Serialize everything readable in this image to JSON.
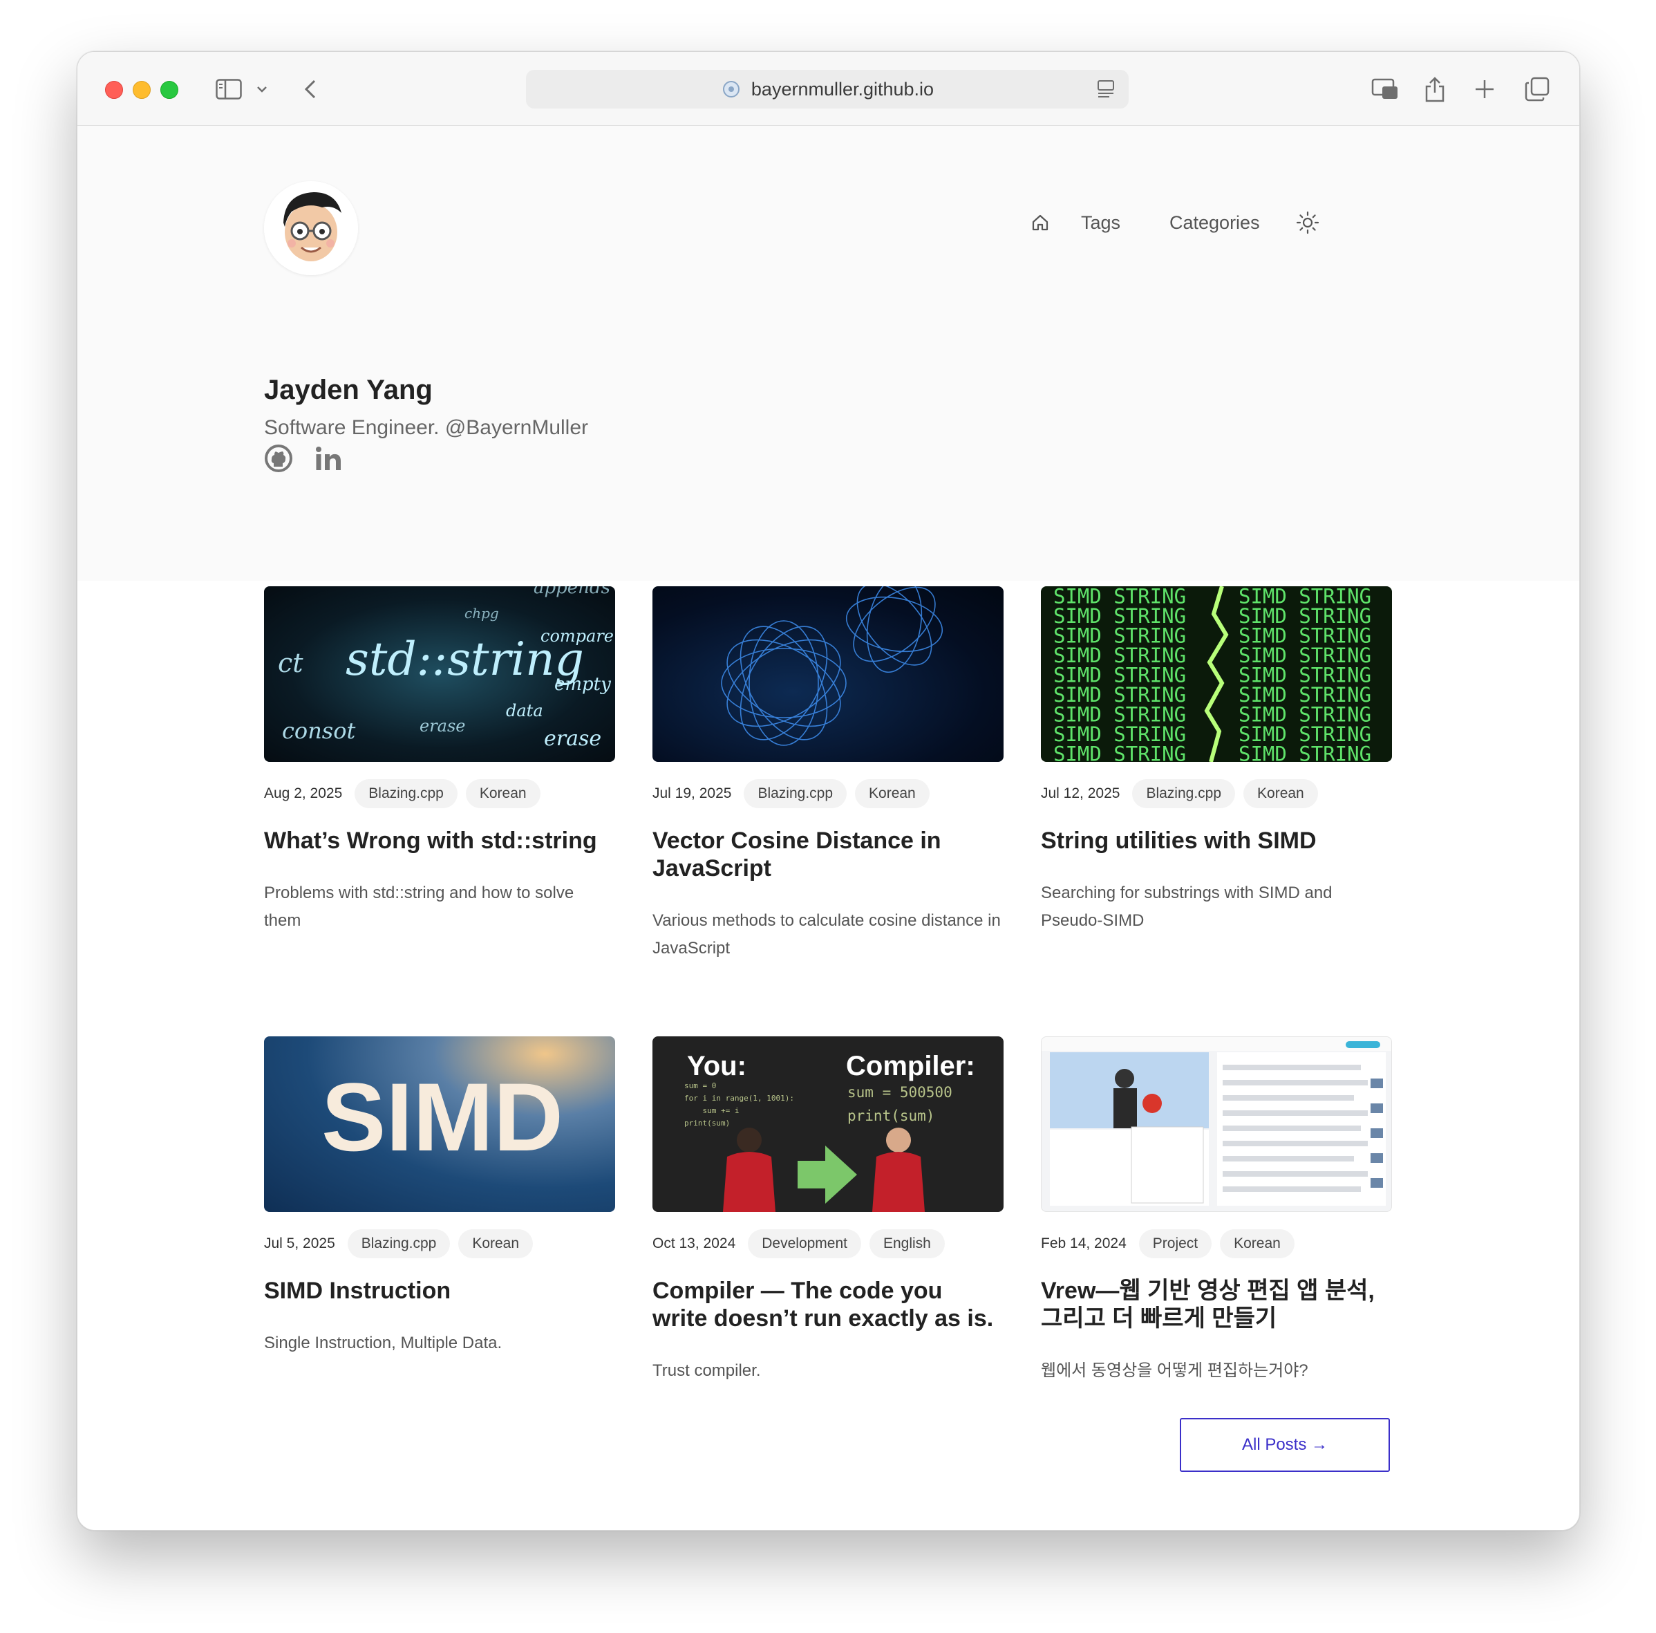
{
  "browser": {
    "url": "bayernmuller.github.io"
  },
  "nav": {
    "home_icon": "home-icon",
    "tags": "Tags",
    "categories": "Categories",
    "theme_icon": "sun-icon"
  },
  "profile": {
    "name": "Jayden Yang",
    "bio": "Software Engineer. @BayernMuller",
    "social": [
      "github-icon",
      "linkedin-icon"
    ]
  },
  "posts": [
    {
      "thumb_words": [
        "std::string",
        "ct",
        "compare",
        "empty",
        "data",
        "erase",
        "erase",
        "consot",
        "chpg",
        "appends"
      ],
      "date": "Aug 2, 2025",
      "category": "Blazing.cpp",
      "lang": "Korean",
      "title": "What’s Wrong with std::string",
      "desc": "Problems with std::string and how to solve them"
    },
    {
      "date": "Jul 19, 2025",
      "category": "Blazing.cpp",
      "lang": "Korean",
      "title": "Vector Cosine Distance in JavaScript",
      "desc": "Various methods to calculate cosine distance in JavaScript"
    },
    {
      "thumb_word": "SIMD STRING",
      "date": "Jul 12, 2025",
      "category": "Blazing.cpp",
      "lang": "Korean",
      "title": "String utilities with SIMD",
      "desc": "Searching for substrings with SIMD and Pseudo-SIMD"
    },
    {
      "thumb_text": "SIMD",
      "date": "Jul 5, 2025",
      "category": "Blazing.cpp",
      "lang": "Korean",
      "title": "SIMD Instruction",
      "desc": "Single Instruction, Multiple Data."
    },
    {
      "thumb_left_label": "You:",
      "thumb_right_label": "Compiler:",
      "thumb_left_code": [
        "sum = 0",
        "for i in range(1, 1001):",
        "    sum += i",
        "print(sum)"
      ],
      "thumb_right_code": [
        "sum = 500500",
        "print(sum)"
      ],
      "date": "Oct 13, 2024",
      "category": "Development",
      "lang": "English",
      "title": "Compiler — The code you write doesn’t run exactly as is.",
      "desc": "Trust compiler."
    },
    {
      "date": "Feb 14, 2024",
      "category": "Project",
      "lang": "Korean",
      "title": "Vrew—웹 기반 영상 편집 앱 분석, 그리고 더 빠르게 만들기",
      "desc": "웹에서 동영상을 어떻게 편집하는거야?"
    }
  ],
  "all_posts": {
    "label": "All Posts →"
  }
}
